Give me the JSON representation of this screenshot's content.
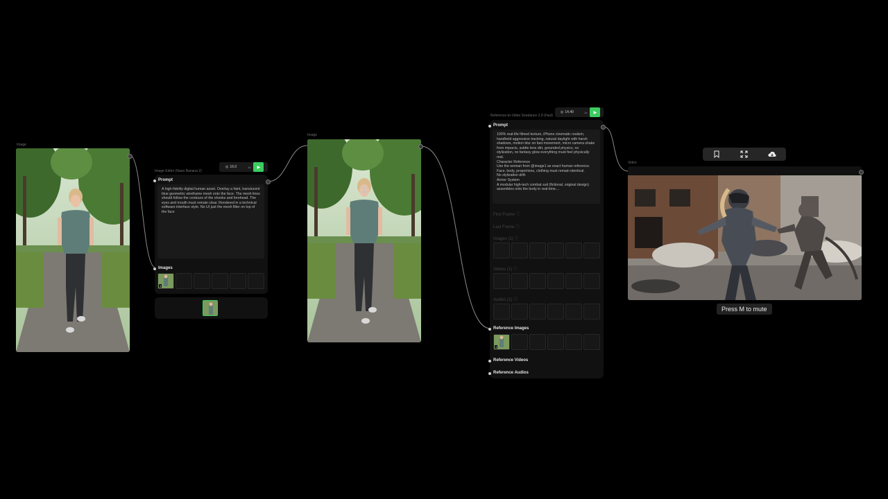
{
  "node1": {
    "label": "Image"
  },
  "editor": {
    "label": "Image Editor (Nano Banana 2)",
    "credits": "16.0",
    "stepper": "1x",
    "run_icon": "play-icon",
    "prompt_label": "Prompt",
    "prompt_text": "A high-fidelity digital human asset. Overlay a faint, translucent blue geometric wireframe mesh onto the face. The mesh lines should follow the contours of the cheeks and forehead. The eyes and mouth must remain clear. Rendered in a technical software interface style. No UI just the mesh filter on top of the face",
    "images_label": "Images",
    "thumb_badge": "1"
  },
  "node3": {
    "label": "Image"
  },
  "r2v": {
    "label": "Reference-to-Video Seedance 2.0 (Fast)",
    "credits": "14.40",
    "stepper": "1x",
    "prompt_label": "Prompt",
    "prompt_text": "100% real-life filmed texture, iPhone cinematic realism, handheld aggressive tracking, natural daylight with harsh shadows, motion blur on fast movement, micro camera shake from impacts, subtle lens dirt, grounded physics, no stylization, no fantasy glow everything must feel physically real.\nCharacter Reference\nUse the woman from @image1 as exact human reference. Face, body, proportions, clothing must remain identical.\nNo stylization drift.\nArmor System\nA modular high-tech combat suit (fictional, original design) assembles onto the body in real-time....",
    "first_frame": "First Frame",
    "last_frame": "Last Frame",
    "ref_group_1": "Images (1)",
    "ref_group_2": "Videos (1)",
    "ref_group_3": "Audios (1)",
    "ref_images_label": "Reference Images",
    "ref_videos_label": "Reference Videos",
    "ref_audios_label": "Reference Audios",
    "thumb_badge": "1"
  },
  "video": {
    "label": "Video",
    "tooltip": "Press M to mute",
    "toolbar_icons": [
      "bookmark-icon",
      "fullscreen-icon",
      "cloud-download-icon"
    ]
  }
}
